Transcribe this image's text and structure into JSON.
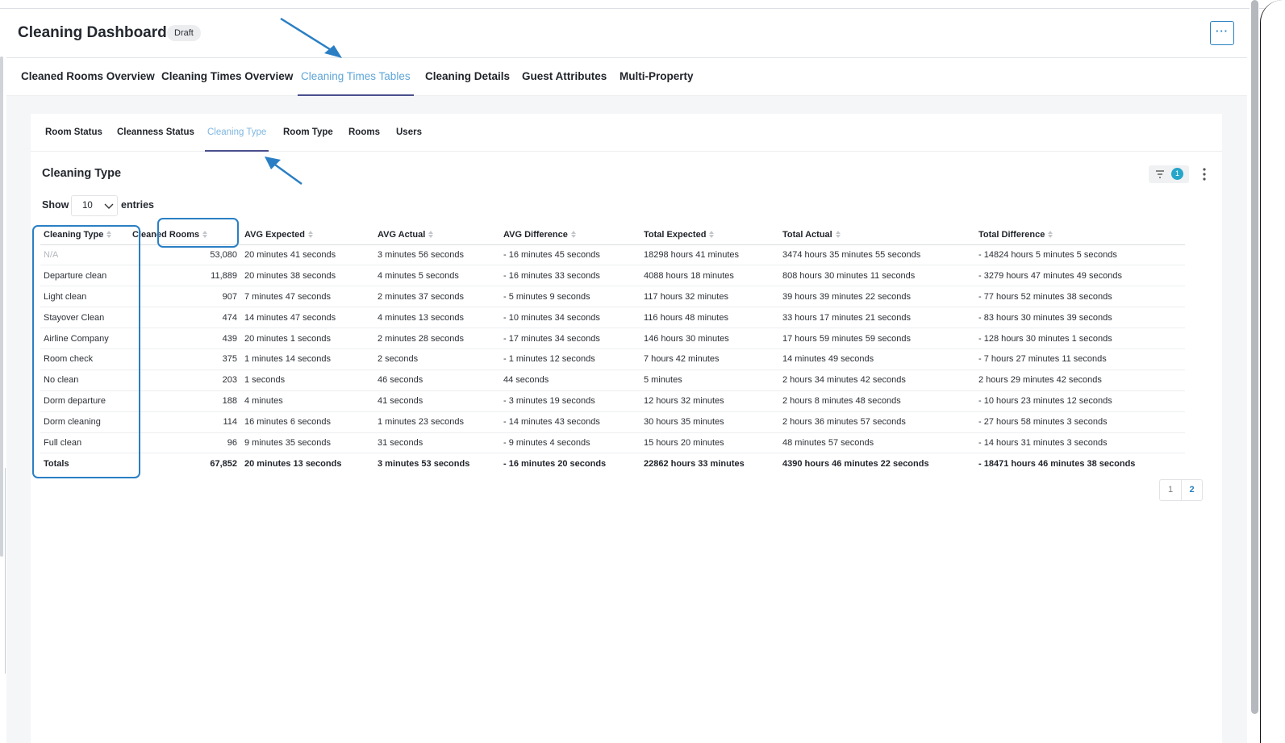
{
  "header": {
    "title": "Cleaning Dashboard",
    "badge": "Draft",
    "more_label": "···"
  },
  "main_tabs": [
    {
      "label": "Cleaned Rooms Overview",
      "active": false
    },
    {
      "label": "Cleaning Times Overview",
      "active": false
    },
    {
      "label": "Cleaning Times Tables",
      "active": true
    },
    {
      "label": "Cleaning Details",
      "active": false
    },
    {
      "label": "Guest Attributes",
      "active": false
    },
    {
      "label": "Multi-Property",
      "active": false
    }
  ],
  "sub_tabs": [
    {
      "label": "Room Status",
      "active": false
    },
    {
      "label": "Cleanness Status",
      "active": false
    },
    {
      "label": "Cleaning Type",
      "active": true
    },
    {
      "label": "Room Type",
      "active": false
    },
    {
      "label": "Rooms",
      "active": false
    },
    {
      "label": "Users",
      "active": false
    }
  ],
  "section": {
    "title": "Cleaning Type",
    "filter_count": "1"
  },
  "show_entries": {
    "show_label": "Show",
    "value": "10",
    "entries_label": "entries"
  },
  "table": {
    "columns": [
      "Cleaning Type",
      "Cleaned Rooms",
      "AVG Expected",
      "AVG Actual",
      "AVG Difference",
      "Total Expected",
      "Total Actual",
      "Total Difference"
    ],
    "rows": [
      [
        "N/A",
        "53,080",
        "20 minutes 41 seconds",
        "3 minutes 56 seconds",
        "- 16 minutes 45 seconds",
        "18298 hours 41 minutes",
        "3474 hours 35 minutes 55 seconds",
        "- 14824 hours 5 minutes 5 seconds"
      ],
      [
        "Departure clean",
        "11,889",
        "20 minutes 38 seconds",
        "4 minutes 5 seconds",
        "- 16 minutes 33 seconds",
        "4088 hours 18 minutes",
        "808 hours 30 minutes 11 seconds",
        "- 3279 hours 47 minutes 49 seconds"
      ],
      [
        "Light clean",
        "907",
        "7 minutes 47 seconds",
        "2 minutes 37 seconds",
        "- 5 minutes 9 seconds",
        "117 hours 32 minutes",
        "39 hours 39 minutes 22 seconds",
        "- 77 hours 52 minutes 38 seconds"
      ],
      [
        "Stayover Clean",
        "474",
        "14 minutes 47 seconds",
        "4 minutes 13 seconds",
        "- 10 minutes 34 seconds",
        "116 hours 48 minutes",
        "33 hours 17 minutes 21 seconds",
        "- 83 hours 30 minutes 39 seconds"
      ],
      [
        "Airline Company",
        "439",
        "20 minutes 1 seconds",
        "2 minutes 28 seconds",
        "- 17 minutes 34 seconds",
        "146 hours 30 minutes",
        "17 hours 59 minutes 59 seconds",
        "- 128 hours 30 minutes 1 seconds"
      ],
      [
        "Room check",
        "375",
        "1 minutes 14 seconds",
        "2 seconds",
        "- 1 minutes 12 seconds",
        "7 hours 42 minutes",
        "14 minutes 49 seconds",
        "- 7 hours 27 minutes 11 seconds"
      ],
      [
        "No clean",
        "203",
        "1 seconds",
        "46 seconds",
        "44 seconds",
        "5 minutes",
        "2 hours 34 minutes 42 seconds",
        "2 hours 29 minutes 42 seconds"
      ],
      [
        "Dorm departure",
        "188",
        "4 minutes",
        "41 seconds",
        "- 3 minutes 19 seconds",
        "12 hours 32 minutes",
        "2 hours 8 minutes 48 seconds",
        "- 10 hours 23 minutes 12 seconds"
      ],
      [
        "Dorm cleaning",
        "114",
        "16 minutes 6 seconds",
        "1 minutes 23 seconds",
        "- 14 minutes 43 seconds",
        "30 hours 35 minutes",
        "2 hours 36 minutes 57 seconds",
        "- 27 hours 58 minutes 3 seconds"
      ],
      [
        "Full clean",
        "96",
        "9 minutes 35 seconds",
        "31 seconds",
        "- 9 minutes 4 seconds",
        "15 hours 20 minutes",
        "48 minutes 57 seconds",
        "- 14 hours 31 minutes 3 seconds"
      ]
    ],
    "totals": [
      "Totals",
      "67,852",
      "20 minutes 13 seconds",
      "3 minutes 53 seconds",
      "- 16 minutes 20 seconds",
      "22862 hours 33 minutes",
      "4390 hours 46 minutes 22 seconds",
      "- 18471 hours 46 minutes 38 seconds"
    ]
  },
  "pagination": {
    "pages": [
      "1",
      "2"
    ],
    "current": "2"
  },
  "colors": {
    "accent": "#2680c2",
    "active_tab_text": "#5ea5d8",
    "tab_underline": "#4a4f8c",
    "annotation_blue": "#2a7fc4",
    "badge_bg": "#ecedef",
    "filter_badge": "#26a6c9"
  },
  "icons": {
    "more": "more-horizontal-icon",
    "filter": "filter-icon",
    "kebab": "kebab-vertical-icon",
    "sort": "sort-icon",
    "chevron": "chevron-down-icon"
  }
}
